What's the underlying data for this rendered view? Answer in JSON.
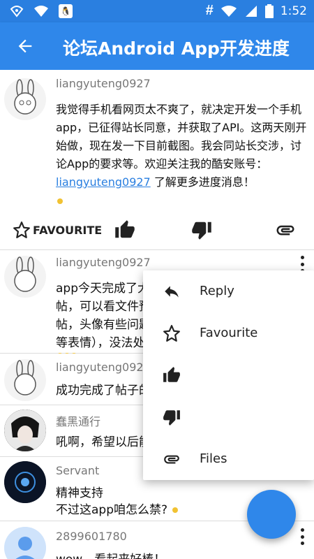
{
  "status_bar": {
    "time": "1:52",
    "icons": [
      "wifi-location-icon",
      "wifi-icon",
      "qq-icon",
      "hash-icon",
      "wifi-signal-icon",
      "cell-signal-icon",
      "battery-icon"
    ]
  },
  "toolbar": {
    "title": "论坛Android App开发进度",
    "back_icon": "arrow-back-icon"
  },
  "posts": [
    {
      "author": "liangyuteng0927",
      "content_before": "我觉得手机看网页太不爽了，就决定开发一个手机app，已征得站长同意，并获取了API。这两天刚开始做，现在发一下目前截图。我会同站长交涉，讨论App的要求等。欢迎关注我的酷安账号：",
      "link": "liangyuteng0927",
      "content_after": " 了解更多进度消息！"
    },
    {
      "author": "liangyuteng0927",
      "line1": "app今天完成了大",
      "line2": "帖，可以看文件预",
      "line3": "帖，头像有些问题",
      "line4": "等表情），没法处"
    },
    {
      "author": "liangyuteng0927",
      "line1": "成功完成了帖子的"
    },
    {
      "author": "蠢黑通行",
      "line1": "吼啊，希望以后能"
    },
    {
      "author": "Servant",
      "line1": "精神支持",
      "line2": "不过这app咱怎么禁?"
    },
    {
      "author": "2899601780",
      "line1": "wow，看起来好棒！"
    }
  ],
  "actions": {
    "favourite_label": "FAVOURITE",
    "icons": [
      "star-outline-icon",
      "thumb-up-icon",
      "thumb-down-icon",
      "attachment-icon"
    ]
  },
  "popup_menu": {
    "items": [
      {
        "label": "Reply",
        "icon": "reply-icon"
      },
      {
        "label": "Favourite",
        "icon": "star-outline-icon"
      },
      {
        "label": "",
        "icon": "thumb-up-icon"
      },
      {
        "label": "",
        "icon": "thumb-down-icon"
      },
      {
        "label": "Files",
        "icon": "attachment-icon"
      }
    ]
  },
  "colors": {
    "primary": "#2f87ea",
    "status_bar": "#2a7fe0",
    "link": "#2a7fe0"
  }
}
